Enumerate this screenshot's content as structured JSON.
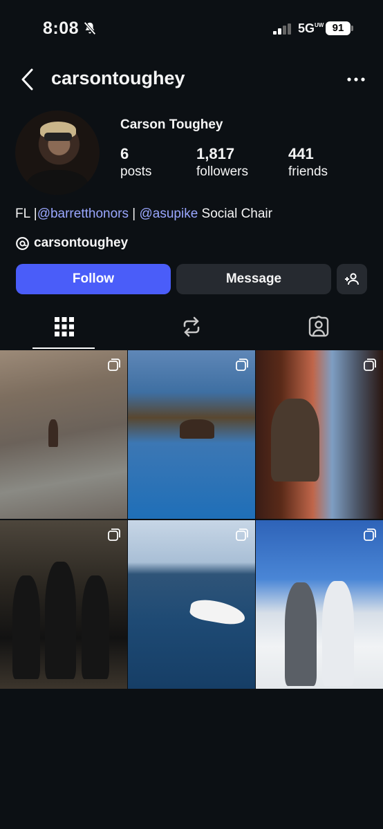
{
  "status_bar": {
    "time": "8:08",
    "network": "5G",
    "network_sup": "UW",
    "battery": "91"
  },
  "header": {
    "username": "carsontoughey"
  },
  "profile": {
    "full_name": "Carson Toughey",
    "stats": [
      {
        "value": "6",
        "label": "posts"
      },
      {
        "value": "1,817",
        "label": "followers"
      },
      {
        "value": "441",
        "label": "friends"
      }
    ],
    "bio": {
      "prefix": "FL |",
      "mention1": "@barretthonors",
      "separator": " | ",
      "mention2": "@asupike",
      "suffix": " Social Chair"
    },
    "threads_handle": "carsontoughey"
  },
  "actions": {
    "follow_label": "Follow",
    "message_label": "Message"
  },
  "tabs": {
    "selected": "grid",
    "items": [
      "grid-icon",
      "reposts-icon",
      "tagged-icon"
    ]
  },
  "posts": [
    {
      "kind": "carousel"
    },
    {
      "kind": "carousel"
    },
    {
      "kind": "carousel"
    },
    {
      "kind": "carousel"
    },
    {
      "kind": "carousel"
    },
    {
      "kind": "carousel"
    }
  ],
  "colors": {
    "background": "#0c1014",
    "follow_button": "#4a5df9",
    "secondary_button": "#262a30",
    "mention": "#9aa7ff"
  }
}
